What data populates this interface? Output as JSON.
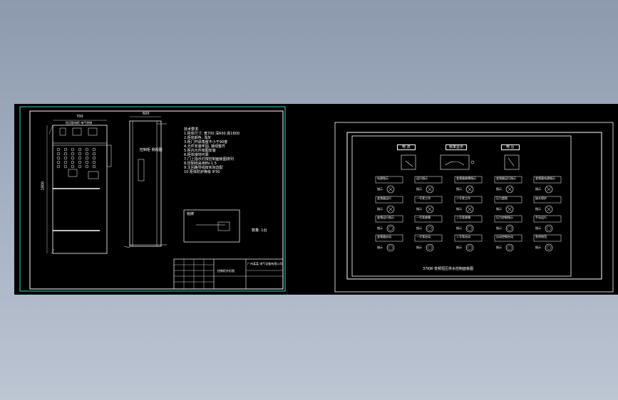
{
  "left_sheet": {
    "dimension_top_front": "700",
    "dimension_top_side": "600",
    "dimension_height": "1800",
    "panel_header": "低压配电柜 电气控制",
    "notes": [
      "技术要求:",
      "1.柜体尺寸: 宽700 深600 高1800",
      "2.柜体颜色: 浅灰",
      "3.柜门开启角度不小于90度",
      "4.元件安装牢固, 接线整齐",
      "5.柜内元件按图安装",
      "6.柜体接地可靠",
      "7.门上指示灯按控制面板图排列",
      "8.控制线采用BV-1.5",
      "9.主回路导线按实际选配",
      "10.柜体防护等级 IP30"
    ],
    "side_label": "控制柜 侧视图",
    "detail_label": "铭牌",
    "quantity_label": "数量: 1台",
    "title_block": {
      "company": "广州某某 电气设备有限公司",
      "drawing_title": "控制柜外形图"
    }
  },
  "right_sheet": {
    "meters": [
      {
        "label": "电 流"
      },
      {
        "label": "频率显示"
      },
      {
        "label": "电 压"
      }
    ],
    "indicator_rows": [
      [
        "电源指示",
        "运行指示",
        "变频器故障指示",
        "变频器运行指示",
        "变频器电源指示"
      ],
      [
        "变频器运行",
        "一号泵工作",
        "二号泵工作",
        "压力超限",
        "缺水保护"
      ],
      [
        "变频运行指示",
        "一号泵故障",
        "二号泵故障",
        "压力控制指示",
        "手动运行"
      ],
      [
        "变频器启动",
        "一号泵启动",
        "二号泵启动",
        "自动控制启动",
        "急停按钮"
      ]
    ],
    "row_tag": "指示",
    "footer_caption": "37KW 变频恒压供水控制面板图"
  },
  "colors": {
    "background": "#8d99ad",
    "sheet": "#000000",
    "left_border": "#3fd0c9",
    "drawing_lines": "#ffffff"
  }
}
